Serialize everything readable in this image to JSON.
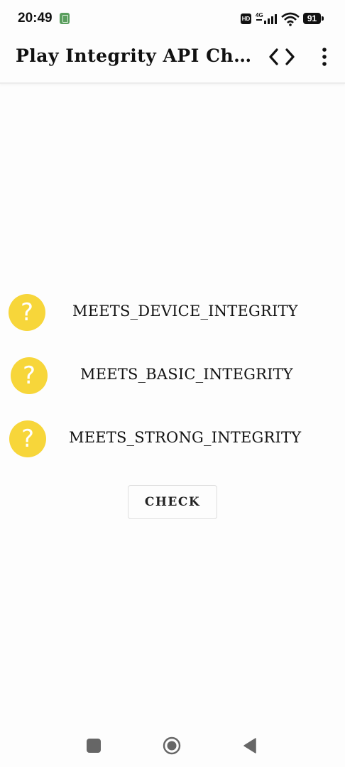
{
  "status_bar": {
    "time": "20:49",
    "hd_label": "HD",
    "network_label": "4G",
    "battery_level": "91",
    "icons": [
      "notification-app-icon",
      "hd-icon",
      "signal-icon",
      "wifi-icon",
      "battery-icon"
    ]
  },
  "app_bar": {
    "title": "Play Integrity API Ch…",
    "actions": [
      "code-icon",
      "more-vert-icon"
    ]
  },
  "results": [
    {
      "label": "MEETS_DEVICE_INTEGRITY",
      "status_icon": "question-icon",
      "status_glyph": "?"
    },
    {
      "label": "MEETS_BASIC_INTEGRITY",
      "status_icon": "question-icon",
      "status_glyph": "?"
    },
    {
      "label": "MEETS_STRONG_INTEGRITY",
      "status_icon": "question-icon",
      "status_glyph": "?"
    }
  ],
  "check_button": {
    "label": "CHECK"
  },
  "nav_bar": {
    "icons": [
      "recents-icon",
      "home-icon",
      "back-icon"
    ]
  },
  "colors": {
    "status_unknown": "#f7d63a",
    "background": "#fdfdfd",
    "text": "#111111"
  }
}
